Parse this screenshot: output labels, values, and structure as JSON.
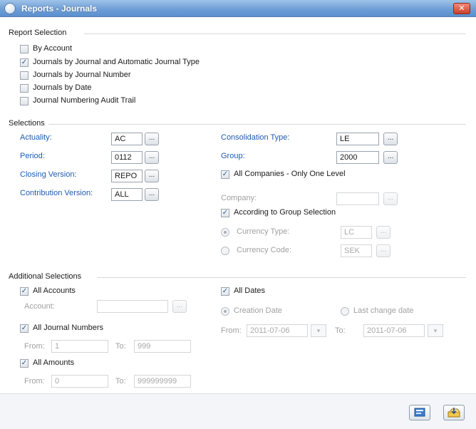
{
  "window": {
    "title": "Reports - Journals",
    "close_label": "✕"
  },
  "report_selection": {
    "title": "Report Selection",
    "options": [
      {
        "label": "By Account",
        "checked": false
      },
      {
        "label": "Journals by Journal and Automatic Journal Type",
        "checked": true
      },
      {
        "label": "Journals by Journal Number",
        "checked": false
      },
      {
        "label": "Journals by Date",
        "checked": false
      },
      {
        "label": "Journal Numbering Audit Trail",
        "checked": false
      }
    ]
  },
  "selections": {
    "title": "Selections",
    "actuality": {
      "label": "Actuality:",
      "value": "AC"
    },
    "period": {
      "label": "Period:",
      "value": "0112"
    },
    "closing_version": {
      "label": "Closing Version:",
      "value": "REPO"
    },
    "contribution_version": {
      "label": "Contribution Version:",
      "value": "ALL"
    },
    "consolidation_type": {
      "label": "Consolidation Type:",
      "value": "LE"
    },
    "group": {
      "label": "Group:",
      "value": "2000"
    },
    "all_companies": {
      "label": "All Companies - Only One Level",
      "checked": true
    },
    "company": {
      "label": "Company:",
      "value": ""
    },
    "according_group": {
      "label": "According to Group Selection",
      "checked": true
    },
    "currency_type": {
      "label": "Currency Type:",
      "value": "LC",
      "selected": true
    },
    "currency_code": {
      "label": "Currency Code:",
      "value": "SEK",
      "selected": false
    }
  },
  "additional": {
    "title": "Additional Selections",
    "all_accounts": {
      "label": "All Accounts",
      "checked": true
    },
    "account": {
      "label": "Account:",
      "value": ""
    },
    "all_journal_numbers": {
      "label": "All Journal Numbers",
      "checked": true
    },
    "journal_from": {
      "label": "From:",
      "value": "1"
    },
    "journal_to": {
      "label": "To:",
      "value": "999"
    },
    "all_amounts": {
      "label": "All Amounts",
      "checked": true
    },
    "amount_from": {
      "label": "From:",
      "value": "0"
    },
    "amount_to": {
      "label": "To:",
      "value": "999999999"
    },
    "all_dates": {
      "label": "All Dates",
      "checked": true
    },
    "creation_date": {
      "label": "Creation Date",
      "selected": true
    },
    "last_change_date": {
      "label": "Last change date",
      "selected": false
    },
    "date_from": {
      "label": "From:",
      "value": "2011-07-06"
    },
    "date_to": {
      "label": "To:",
      "value": "2011-07-06"
    }
  },
  "dots_label": "...",
  "dropdown_arrow": "▾",
  "check_mark": "✓",
  "icons": {
    "app": "app-logo-icon",
    "run_report": "run-report-icon",
    "export": "export-icon"
  }
}
